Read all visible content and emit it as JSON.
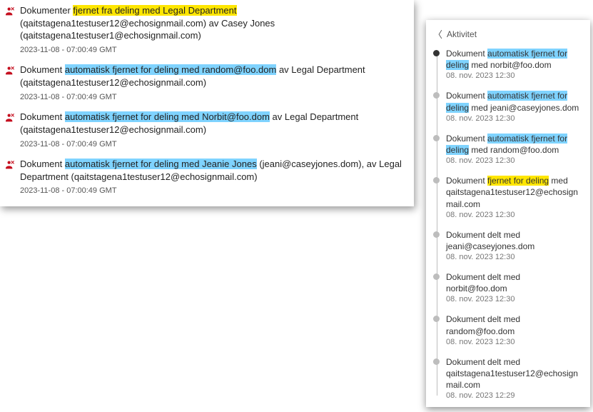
{
  "audit": [
    {
      "segments": [
        {
          "t": "Dokumenter "
        },
        {
          "t": "fjernet fra deling med Legal Department",
          "hl": "yellow"
        },
        {
          "t": " (qaitstagena1testuser12@echosignmail.com) av Casey Jones (qaitstagena1testuser1@echosignmail.com)"
        }
      ],
      "ts": "2023-11-08 - 07:00:49 GMT"
    },
    {
      "segments": [
        {
          "t": "Dokument "
        },
        {
          "t": "automatisk fjernet for deling med random@foo.dom",
          "hl": "blue"
        },
        {
          "t": " av Legal Department (qaitstagena1testuser12@echosignmail.com)"
        }
      ],
      "ts": "2023-11-08 - 07:00:49 GMT"
    },
    {
      "segments": [
        {
          "t": "Dokument "
        },
        {
          "t": "automatisk fjernet for deling med Norbit@foo.dom",
          "hl": "blue"
        },
        {
          "t": " av Legal Department (qaitstagena1testuser12@echosignmail.com)"
        }
      ],
      "ts": "2023-11-08 - 07:00:49 GMT"
    },
    {
      "segments": [
        {
          "t": "Dokument "
        },
        {
          "t": "automatisk fjernet for deling med Jeanie Jones",
          "hl": "blue"
        },
        {
          "t": " (jeani@caseyjones.dom), av Legal Department (qaitstagena1testuser12@echosignmail.com)"
        }
      ],
      "ts": "2023-11-08 - 07:00:49 GMT"
    }
  ],
  "activity": {
    "header": "Aktivitet",
    "items": [
      {
        "current": true,
        "segments": [
          {
            "t": "Dokument "
          },
          {
            "t": "automatisk fjernet for deling",
            "hl": "blue"
          },
          {
            "t": " med norbit@foo.dom"
          }
        ],
        "ts": "08. nov. 2023 12:30"
      },
      {
        "segments": [
          {
            "t": "Dokument "
          },
          {
            "t": "automatisk fjernet for deling",
            "hl": "blue"
          },
          {
            "t": " med jeani@caseyjones.dom"
          }
        ],
        "ts": "08. nov. 2023 12:30"
      },
      {
        "segments": [
          {
            "t": "Dokument "
          },
          {
            "t": "automatisk fjernet for deling",
            "hl": "blue"
          },
          {
            "t": " med random@foo.dom"
          }
        ],
        "ts": "08. nov. 2023 12:30"
      },
      {
        "segments": [
          {
            "t": "Dokument "
          },
          {
            "t": "fjernet for deling",
            "hl": "yellow"
          },
          {
            "t": " med qaitstagena1testuser12@echosignmail.com"
          }
        ],
        "ts": "08. nov. 2023 12:30"
      },
      {
        "segments": [
          {
            "t": "Dokument delt med jeani@caseyjones.dom"
          }
        ],
        "ts": "08. nov. 2023 12:30"
      },
      {
        "segments": [
          {
            "t": "Dokument delt med norbit@foo.dom"
          }
        ],
        "ts": "08. nov. 2023 12:30"
      },
      {
        "segments": [
          {
            "t": "Dokument delt med random@foo.dom"
          }
        ],
        "ts": "08. nov. 2023 12:30"
      },
      {
        "segments": [
          {
            "t": "Dokument delt med qaitstagena1testuser12@echosignmail.com"
          }
        ],
        "ts": "08. nov. 2023 12:29"
      }
    ]
  }
}
